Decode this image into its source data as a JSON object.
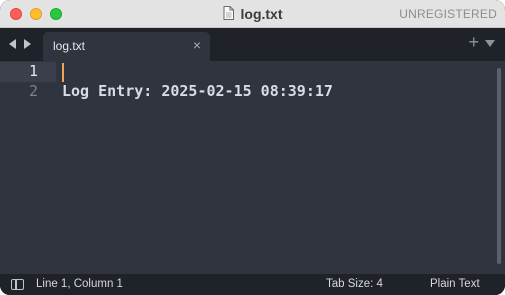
{
  "window": {
    "title": "log.txt",
    "unregistered_label": "UNREGISTERED"
  },
  "tabs": [
    {
      "label": "log.txt",
      "close_glyph": "×"
    }
  ],
  "tabbar": {
    "plus_glyph": "+"
  },
  "editor": {
    "lines": [
      {
        "number": "1",
        "text": ""
      },
      {
        "number": "2",
        "text": "Log Entry: 2025-02-15 08:39:17"
      }
    ],
    "cursor": {
      "line": 1,
      "column": 1
    }
  },
  "statusbar": {
    "position": "Line 1, Column 1",
    "tab_size": "Tab Size: 4",
    "syntax": "Plain Text"
  },
  "icons": {
    "document": "document-icon",
    "sidebar_toggle": "panel-icon"
  },
  "colors": {
    "editor_bg": "#2f343f",
    "chrome_bg": "#1f2228",
    "cursor": "#f0a35c"
  }
}
